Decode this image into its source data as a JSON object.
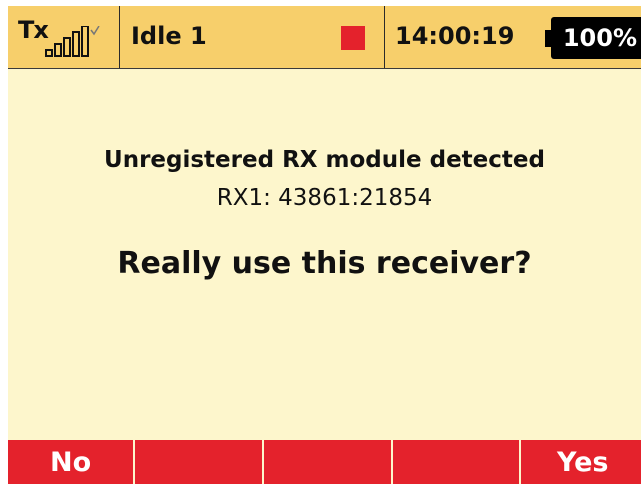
{
  "status_bar": {
    "tx_label": "Tx",
    "signal_icon": "signal-strength-icon",
    "model_name": "Idle 1",
    "alarm_indicator_color": "#e4222c",
    "time": "14:00:19",
    "battery_percent": "100%"
  },
  "dialog": {
    "title": "Unregistered RX module detected",
    "receiver_id": "RX1: 43861:21854",
    "question": "Really use this receiver?"
  },
  "softkeys": {
    "left_label": "No",
    "right_label": "Yes",
    "middle_labels": [
      "",
      "",
      ""
    ]
  },
  "colors": {
    "status_bar_bg": "#f7cf6b",
    "screen_bg": "#fdf6cc",
    "softkey_bg": "#e4222c",
    "battery_bg": "#000000"
  }
}
